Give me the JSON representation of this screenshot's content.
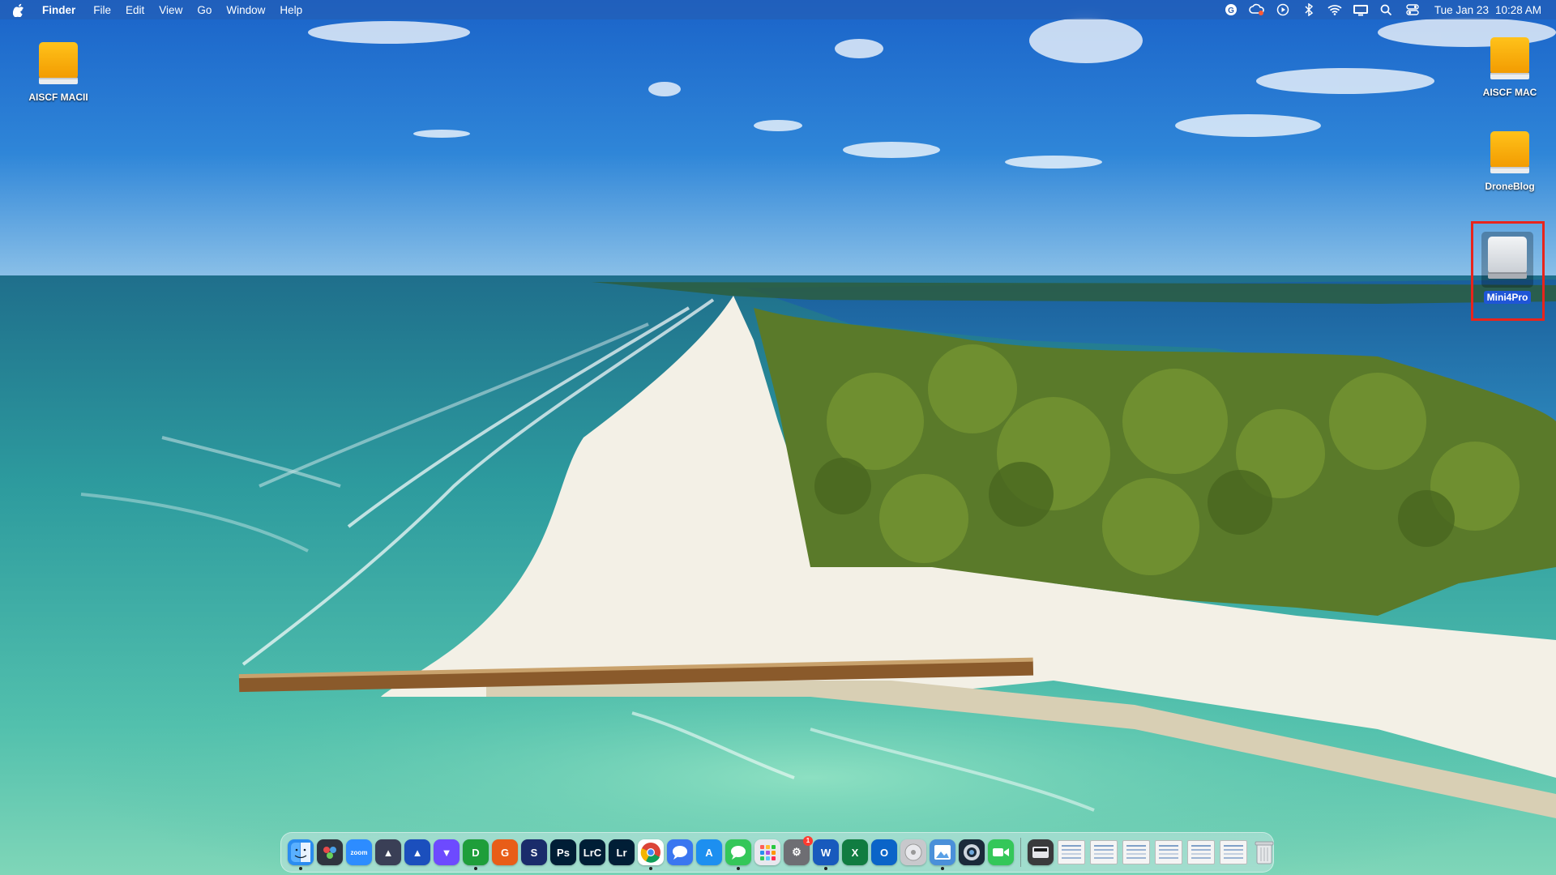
{
  "menubar": {
    "app_name": "Finder",
    "menus": [
      "File",
      "Edit",
      "View",
      "Go",
      "Window",
      "Help"
    ],
    "status_icons": [
      "grammarly-icon",
      "creative-cloud-icon",
      "play-circle-icon",
      "bluetooth-icon",
      "wifi-icon",
      "display-icon",
      "spotlight-search-icon",
      "control-center-icon"
    ],
    "date": "Tue Jan 23",
    "time": "10:28 AM"
  },
  "desktop": {
    "icons": [
      {
        "label": "AISCF MACII",
        "kind": "external-drive"
      },
      {
        "label": "AISCF MAC",
        "kind": "external-drive"
      },
      {
        "label": "DroneBlog",
        "kind": "external-drive"
      },
      {
        "label": "Mini4Pro",
        "kind": "removable-drive",
        "selected": true
      }
    ],
    "highlight_color": "#e8241c"
  },
  "dock": {
    "apps": [
      {
        "name": "finder",
        "glyph": "",
        "color": "#2a8cf0",
        "running": true
      },
      {
        "name": "davinci-resolve",
        "glyph": "",
        "color": "#2f3440"
      },
      {
        "name": "zoom",
        "glyph": "zoom",
        "color": "#2d8cff"
      },
      {
        "name": "affinity-photo-triangle",
        "glyph": "▲",
        "color": "#3a3f56"
      },
      {
        "name": "affinity-designer",
        "glyph": "▲",
        "color": "#1b4fbd"
      },
      {
        "name": "proton-vpn",
        "glyph": "▼",
        "color": "#6d4aff"
      },
      {
        "name": "dxo",
        "glyph": "D",
        "color": "#1e9e3a",
        "running": true
      },
      {
        "name": "gyroflow",
        "glyph": "G",
        "color": "#e85d18"
      },
      {
        "name": "skylum-s",
        "glyph": "S",
        "color": "#1a2c6b"
      },
      {
        "name": "photoshop",
        "glyph": "Ps",
        "color": "#001e36"
      },
      {
        "name": "lightroom-classic",
        "glyph": "LrC",
        "color": "#001e36"
      },
      {
        "name": "lightroom",
        "glyph": "Lr",
        "color": "#001e36"
      },
      {
        "name": "chrome",
        "glyph": "",
        "color": "#ffffff",
        "running": true
      },
      {
        "name": "signal",
        "glyph": "",
        "color": "#3a76f0"
      },
      {
        "name": "app-store",
        "glyph": "A",
        "color": "#1d8ff0"
      },
      {
        "name": "messages",
        "glyph": "",
        "color": "#34c759",
        "running": true
      },
      {
        "name": "launchpad",
        "glyph": "",
        "color": "#e8e8ee"
      },
      {
        "name": "system-settings",
        "glyph": "⚙",
        "color": "#6e6e73",
        "badge": "1"
      },
      {
        "name": "word",
        "glyph": "W",
        "color": "#185abd",
        "running": true
      },
      {
        "name": "excel",
        "glyph": "X",
        "color": "#107c41"
      },
      {
        "name": "outlook",
        "glyph": "O",
        "color": "#0a64c8"
      },
      {
        "name": "disk-utility",
        "glyph": "",
        "color": "#c8c8cc"
      },
      {
        "name": "preview",
        "glyph": "",
        "color": "#4a90d9",
        "running": true
      },
      {
        "name": "quicktime",
        "glyph": "",
        "color": "#1b2a3a"
      },
      {
        "name": "facetime",
        "glyph": "",
        "color": "#34c759"
      }
    ],
    "documents_count_label": "",
    "trash": "trash-icon"
  }
}
